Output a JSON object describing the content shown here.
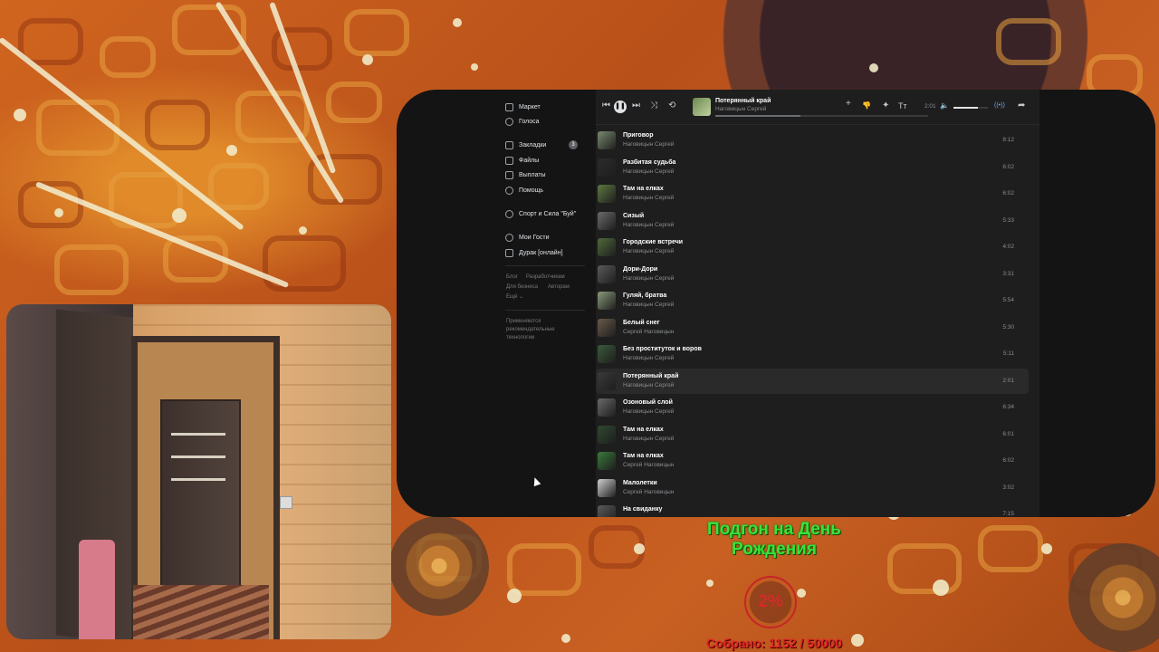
{
  "sidebar": {
    "items": [
      {
        "label": "Маркет",
        "icon": "market-icon"
      },
      {
        "label": "Голоса",
        "icon": "votes-icon"
      },
      {
        "label": "Закладки",
        "icon": "bookmark-icon",
        "badge": "3"
      },
      {
        "label": "Файлы",
        "icon": "file-icon"
      },
      {
        "label": "Выплаты",
        "icon": "payments-icon"
      },
      {
        "label": "Помощь",
        "icon": "help-icon"
      },
      {
        "label": "Спорт и Сила \"Буй\"",
        "icon": "community-icon"
      },
      {
        "label": "Мои Гости",
        "icon": "guests-icon"
      },
      {
        "label": "Дурак [онлайн]",
        "icon": "game-icon"
      }
    ],
    "footer_links": {
      "blog": "Блог",
      "developers": "Разработчикам",
      "business": "Для бизнеса",
      "authors": "Авторам",
      "more": "Ещё ⌄"
    },
    "recommendation_note": "Применяются рекомендательные технологии"
  },
  "player": {
    "now_playing_title": "Потерянный край",
    "now_playing_artist": "Наговицын Сергей",
    "elapsed": "2:01",
    "progress": 0.29,
    "loaded": 0.4,
    "volume": 0.7,
    "controls": {
      "prev": "⏮",
      "pause": "❚❚",
      "next": "⏭",
      "shuffle": "⤨",
      "repeat": "⟲",
      "add": "+",
      "dislike": "👎",
      "magic": "✦",
      "lyrics": "Тт",
      "mute": "🔈",
      "broadcast": "((•))",
      "share": "➦"
    }
  },
  "tracks": [
    {
      "title": "Приговор",
      "artist": "Наговицын Сергей",
      "duration": "8:12"
    },
    {
      "title": "Разбитая судьба",
      "artist": "Наговицын Сергей",
      "duration": "6:02"
    },
    {
      "title": "Там на елках",
      "artist": "Наговицын Сергей",
      "duration": "6:02"
    },
    {
      "title": "Сизый",
      "artist": "Наговицын Сергей",
      "duration": "5:33"
    },
    {
      "title": "Городские встречи",
      "artist": "Наговицын Сергей",
      "duration": "4:02"
    },
    {
      "title": "Дори-Дори",
      "artist": "Наговицын Сергей",
      "duration": "3:31"
    },
    {
      "title": "Гуляй, братва",
      "artist": "Наговицын Сергей",
      "duration": "5:54"
    },
    {
      "title": "Белый снег",
      "artist": "Сергей Наговицын",
      "duration": "5:30"
    },
    {
      "title": "Без проституток и воров",
      "artist": "Наговицын Сергей",
      "duration": "5:11"
    },
    {
      "title": "Потерянный край",
      "artist": "Наговицын Сергей",
      "duration": "2:01"
    },
    {
      "title": "Озоновый слой",
      "artist": "Наговицын Сергей",
      "duration": "6:34"
    },
    {
      "title": "Там на елках",
      "artist": "Наговицын Сергей",
      "duration": "6:01"
    },
    {
      "title": "Там на елках",
      "artist": "Сергей Наговицын",
      "duration": "6:02"
    },
    {
      "title": "Малолетки",
      "artist": "Сергей Наговицын",
      "duration": "3:02"
    },
    {
      "title": "На свиданку",
      "artist": "",
      "duration": "7:15"
    }
  ],
  "active_track_index": 9,
  "donation_goal": {
    "title_line1": "Подгон на День",
    "title_line2": "Рождения",
    "percent": "2%",
    "collected": "Собрано: 1152 / 50000",
    "title_color": "#39e33a",
    "accent_color": "#e02424"
  },
  "colors": {
    "app_bg": "#141414",
    "list_bg": "#1e1e1e",
    "text_primary": "#e1e3e6",
    "text_secondary": "#8a8d91"
  }
}
